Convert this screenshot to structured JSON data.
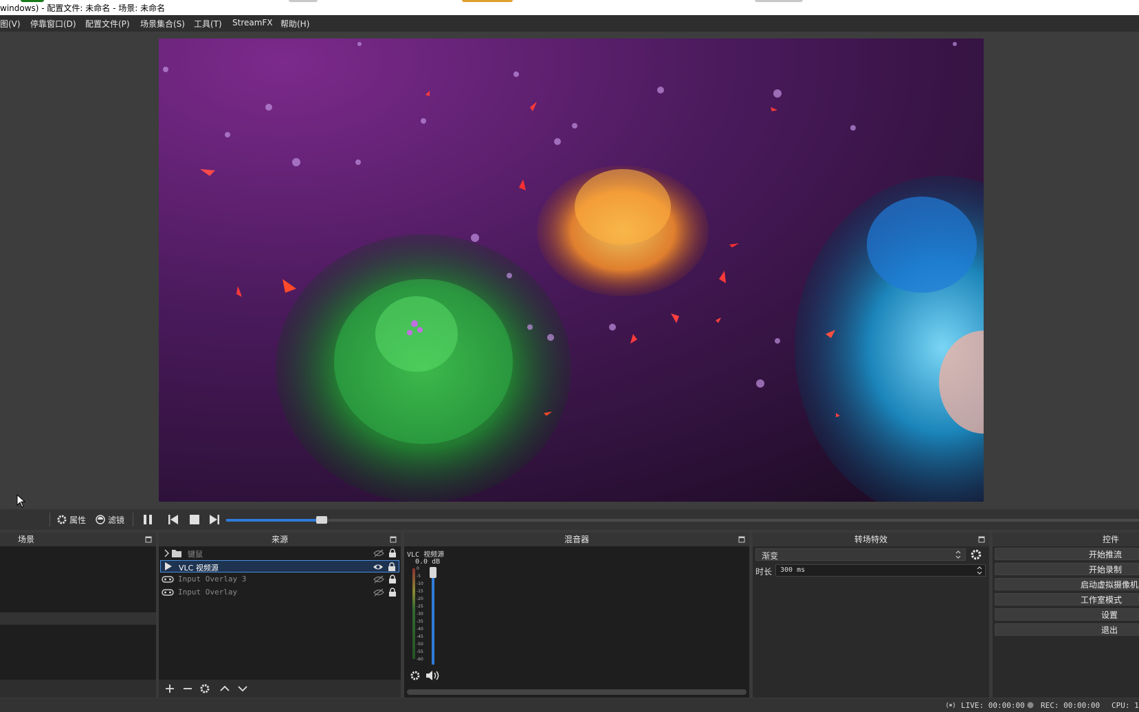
{
  "window": {
    "title": "windows) - 配置文件: 未命名 - 场景: 未命名"
  },
  "menu": {
    "items": [
      "图(V)",
      "停靠窗口(D)",
      "配置文件(P)",
      "场景集合(S)",
      "工具(T)",
      "StreamFX",
      "帮助(H)"
    ]
  },
  "controls_bar": {
    "properties_label": "属性",
    "filters_label": "滤镜",
    "seek_progress": 0.1
  },
  "docks": {
    "scenes": {
      "title": "场景"
    },
    "sources": {
      "title": "来源",
      "items": [
        {
          "label": "键鼠",
          "type": "group-folder",
          "visible": false
        },
        {
          "label": "VLC 视频源",
          "type": "play-icon",
          "visible": true,
          "selected": true
        },
        {
          "label": "Input Overlay 3",
          "type": "gamepad-icon",
          "visible": false
        },
        {
          "label": "Input Overlay",
          "type": "gamepad-icon",
          "visible": false
        }
      ]
    },
    "mixer": {
      "title": "混音器",
      "channel_name": "VLC 视频源",
      "level": "0.0 dB",
      "scale": [
        "0",
        "-5",
        "-10",
        "-15",
        "-20",
        "-25",
        "-30",
        "-35",
        "-40",
        "-45",
        "-50",
        "-55",
        "-60"
      ]
    },
    "transitions": {
      "title": "转场特效",
      "selected": "渐变",
      "duration_label": "时长",
      "duration_value": "300 ms"
    },
    "controls": {
      "title": "控件",
      "buttons": [
        "开始推流",
        "开始录制",
        "启动虚拟摄像机",
        "工作室模式",
        "设置",
        "退出"
      ]
    }
  },
  "status": {
    "live": "LIVE: 00:00:00",
    "rec": "REC: 00:00:00",
    "cpu": "CPU: 1"
  },
  "colors": {
    "accent": "#2f7bd8",
    "selection_border": "#4a90e2"
  }
}
